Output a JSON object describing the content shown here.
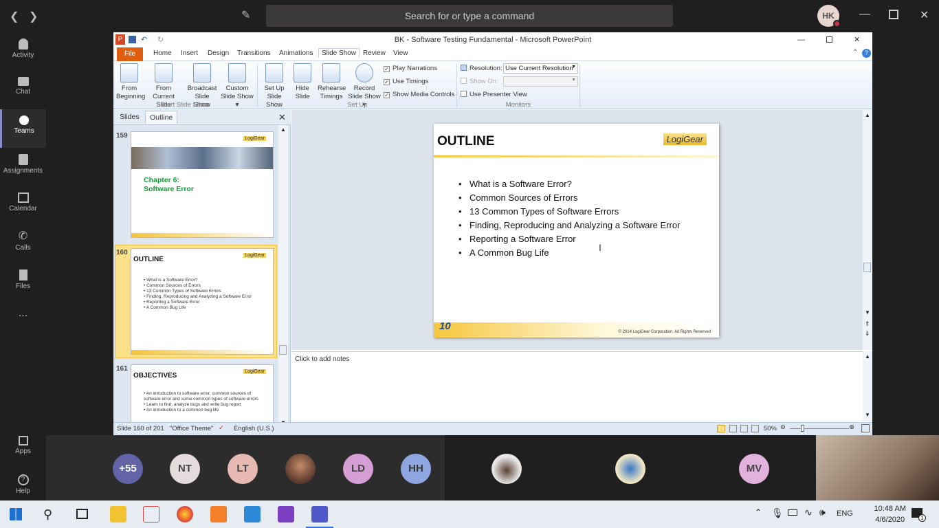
{
  "teams": {
    "search_placeholder": "Search for or type a command",
    "user_initials": "HK",
    "rail": [
      {
        "label": "Activity"
      },
      {
        "label": "Chat"
      },
      {
        "label": "Teams"
      },
      {
        "label": "Assignments"
      },
      {
        "label": "Calendar"
      },
      {
        "label": "Calls"
      },
      {
        "label": "Files"
      },
      {
        "label": "..."
      },
      {
        "label": "Apps"
      },
      {
        "label": "Help"
      }
    ]
  },
  "ppt": {
    "window_title": "BK - Software Testing Fundamental - Microsoft PowerPoint",
    "tabs": [
      "File",
      "Home",
      "Insert",
      "Design",
      "Transitions",
      "Animations",
      "Slide Show",
      "Review",
      "View"
    ],
    "ribbon": {
      "from_beginning": "From Beginning",
      "from_current": "From Current Slide",
      "broadcast": "Broadcast Slide Show",
      "custom": "Custom Slide Show ▾",
      "group_start": "Start Slide Show",
      "setup": "Set Up Slide Show",
      "hide": "Hide Slide",
      "rehearse": "Rehearse Timings",
      "record": "Record Slide Show ▾",
      "play_narrations": "Play Narrations",
      "use_timings": "Use Timings",
      "show_media": "Show Media Controls",
      "group_setup": "Set Up",
      "resolution_label": "Resolution:",
      "resolution_value": "Use Current Resolution",
      "show_on_label": "Show On:",
      "presenter_view": "Use Presenter View",
      "group_monitors": "Monitors"
    },
    "panel": {
      "tab_slides": "Slides",
      "tab_outline": "Outline",
      "logo": "LogiGear",
      "thumbs": [
        {
          "num": "159",
          "title": "Chapter 6:\nSoftware Error"
        },
        {
          "num": "160",
          "title": "OUTLINE",
          "items": [
            "What is a Software Error?",
            "Common Sources of Errors",
            "13 Common Types of Software Errors",
            "Finding, Reproducing and Analyzing a Software Error",
            "Reporting a Software Error",
            "A Common Bug Life"
          ]
        },
        {
          "num": "161",
          "title": "OBJECTIVES",
          "items": [
            "An introduction to software error, common sources of software error and some common types of software errors",
            "Learn to find, analyze bugs and write bug report",
            "An introduction to a common bug life"
          ]
        }
      ]
    },
    "slide": {
      "title": "OUTLINE",
      "logo": "LogiGear",
      "items": [
        "What is a Software Error?",
        "Common Sources of Errors",
        "13 Common Types of Software Errors",
        "Finding, Reproducing and Analyzing a Software Error",
        "Reporting a Software Error",
        "A Common Bug Life"
      ],
      "copyright": "© 2014 LogiGear Corporation. All Rights Reserved",
      "badge": "10"
    },
    "notes_placeholder": "Click to add notes",
    "status": {
      "slide_pos": "Slide 160 of 201",
      "theme": "\"Office Theme\"",
      "language": "English (U.S.)",
      "zoom": "50%"
    }
  },
  "participants": {
    "overflow": "+55",
    "people": [
      {
        "initials": "NT",
        "color": "#e4dcdc"
      },
      {
        "initials": "LT",
        "color": "#e6b9b3"
      },
      {
        "initials": "LD",
        "color": "#d59fd6"
      },
      {
        "initials": "HH",
        "color": "#8fa7e0"
      },
      {
        "initials": "MV",
        "color": "#e2b1dd"
      }
    ],
    "overflow_color": "#6264a7"
  },
  "taskbar": {
    "time": "10:48 AM",
    "date": "4/6/2020",
    "lang": "ENG",
    "notif_count": "1"
  }
}
